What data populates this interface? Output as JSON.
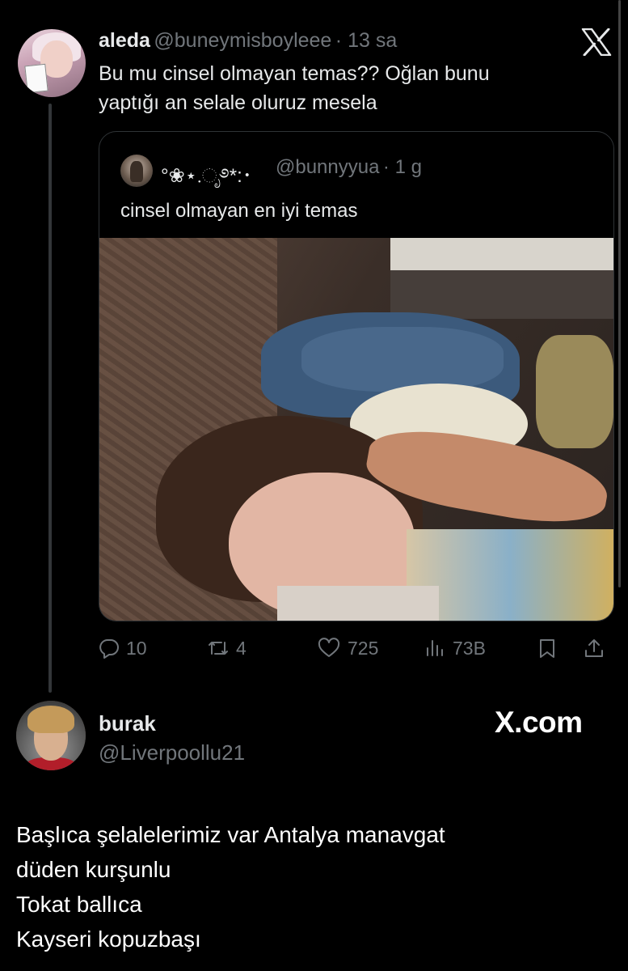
{
  "tweet": {
    "author_name": "aleda",
    "author_handle": "@buneymisboyleee",
    "time": "· 13 sa",
    "text_lines": [
      "Bu mu cinsel olmayan temas?? Oğlan bunu",
      "yaptığı an selale oluruz mesela"
    ],
    "quoted": {
      "author_name": "°❀⋆.ೃ࿔*:･",
      "author_handle": "@bunnyyua",
      "time": "· 1 g",
      "text": "cinsel olmayan en iyi temas"
    },
    "actions": {
      "replies": "10",
      "reposts": "4",
      "likes": "725",
      "views": "73B"
    }
  },
  "reply": {
    "author_name": "burak",
    "author_handle": "@Liverpoollu21",
    "brand": "X.com",
    "text_lines": [
      "Başlıca şelalelerimiz var Antalya manavgat",
      "düden kurşunlu",
      "Tokat ballıca",
      "Kayseri kopuzbaşı"
    ]
  },
  "icons": [
    "x-logo-icon",
    "reply-icon",
    "repost-icon",
    "like-icon",
    "views-icon",
    "bookmark-icon",
    "share-icon"
  ],
  "colors": {
    "background": "#000000",
    "text": "#e7e9ea",
    "muted": "#71767b",
    "border": "#2f3336"
  }
}
